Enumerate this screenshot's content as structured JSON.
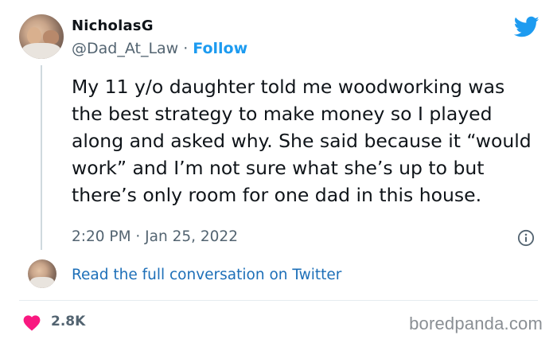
{
  "tweet": {
    "author_name": "NicholasG",
    "author_handle": "@Dad_At_Law",
    "separator": "·",
    "follow_label": "Follow",
    "text": "My 11 y/o daughter told me woodworking was the best strategy to make money so I played along and asked why. She said because it “would work” and I’m not sure what she’s up to but there’s only room for one dad in this house.",
    "timestamp": "2:20 PM · Jan 25, 2022",
    "read_more_label": "Read the full conversation on Twitter",
    "likes_count": "2.8K"
  },
  "watermark": "boredpanda.com",
  "icons": {
    "brand": "twitter-bird-icon",
    "info": "info-icon",
    "like": "heart-icon"
  },
  "colors": {
    "twitter_blue": "#1d9bf0",
    "link_blue": "#1d6fb8",
    "heart_red": "#f91880",
    "secondary_text": "#536471"
  }
}
